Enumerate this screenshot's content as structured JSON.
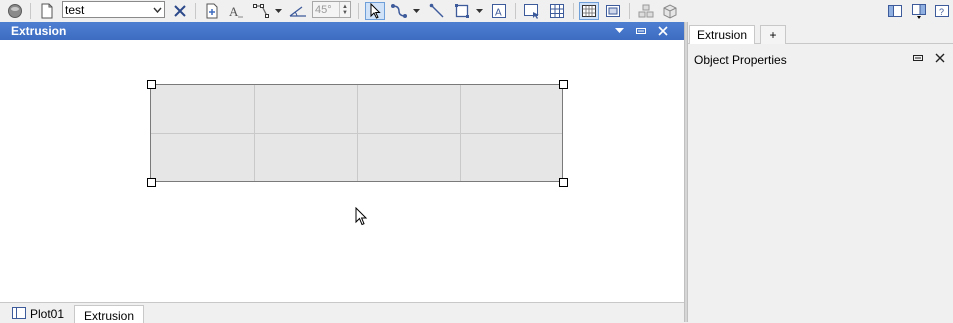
{
  "toolbar": {
    "document_combo_value": "test",
    "angle_value": "45°",
    "icons": [
      "globe-icon",
      "new-document-icon",
      "close-x-icon",
      "export-icon",
      "text-style-icon",
      "node-path-icon",
      "line-angle-icon",
      "select-arrow-icon",
      "connector-icon",
      "line-tool-icon",
      "rectangle-tool-icon",
      "text-box-icon",
      "shape-select-icon",
      "grid-icon",
      "snap-grid-icon",
      "snap-object-icon",
      "stack-icon",
      "cube-icon",
      "layout-left-icon",
      "layout-dock-icon",
      "help-icon"
    ]
  },
  "main_panel": {
    "title": "Extrusion",
    "header_icons": [
      "menu-down-icon",
      "minimize-icon",
      "close-icon"
    ]
  },
  "bottom_tabs": [
    {
      "label": "Plot01",
      "icon": "plot-icon"
    },
    {
      "label": "Extrusion",
      "active": true
    }
  ],
  "right_panel": {
    "tabs": [
      {
        "label": "Extrusion",
        "active": true
      },
      {
        "label": "+"
      }
    ],
    "object_properties_title": "Object Properties"
  },
  "colors": {
    "header_blue": "#4675cc",
    "selection_fill": "#e6e6e6"
  }
}
